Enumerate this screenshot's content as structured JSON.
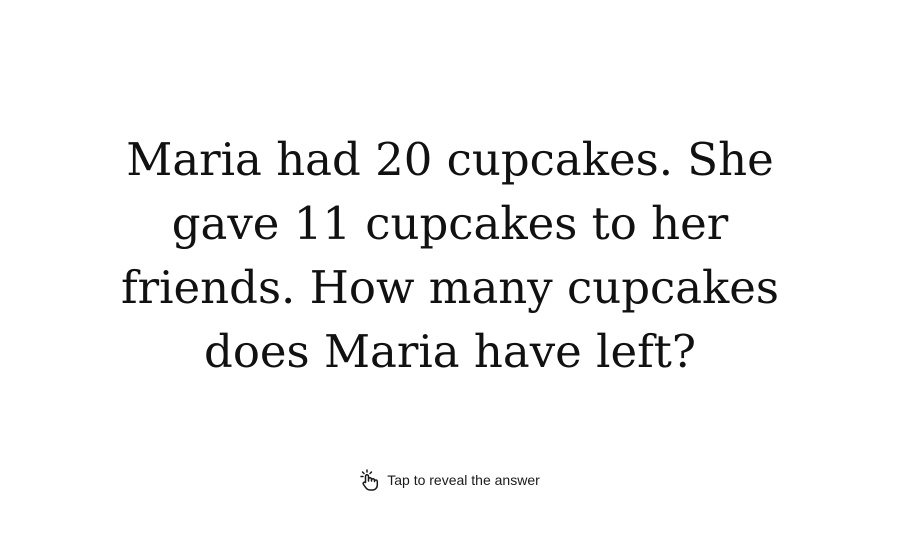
{
  "question": {
    "text": "Maria had 20 cupcakes. She gave 11 cupcakes to her friends. How many cupcakes does Maria have left?"
  },
  "reveal": {
    "label": "Tap to reveal the answer",
    "icon": "tap-hand-icon"
  },
  "colors": {
    "background": "#ffffff",
    "text": "#111111"
  }
}
